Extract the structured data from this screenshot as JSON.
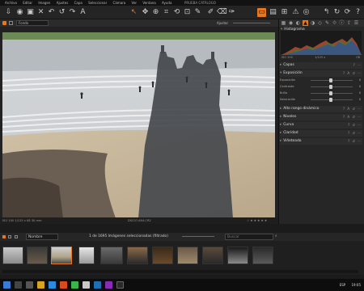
{
  "menu": {
    "items": [
      "Archivo",
      "Editar",
      "Imagen",
      "Ajustes",
      "Capa",
      "Seleccionar",
      "Cámara",
      "Ver",
      "Ventana",
      "Ayuda"
    ],
    "catalog": "PRUEBA CATÁLOGO"
  },
  "viewer": {
    "fondo_label": "Fondo",
    "ajustar_label": "Ajustar",
    "status_left": "ISO 100    1/125 s    f/8    30 mm",
    "status_center": "DSC07-604.CR2",
    "rating": "☆ ★ ★ ★ ★ ★"
  },
  "panel": {
    "histograma": "Histograma",
    "histo_info_left": "ISO 100",
    "histo_info_center": "1/125 s",
    "histo_info_right": "f/8",
    "capas": "Capas",
    "exposicion": "Exposición",
    "sliders": [
      {
        "label": "Exposición",
        "value": "0"
      },
      {
        "label": "Contraste",
        "value": "0"
      },
      {
        "label": "Brillo",
        "value": "0"
      },
      {
        "label": "Saturación",
        "value": "0"
      }
    ],
    "alto_rango": "Alto rango dinámico",
    "niveles": "Niveles",
    "curva": "Curva",
    "claridad": "Claridad",
    "vineteado": "Viñeteado"
  },
  "browser": {
    "sort_label": "Nombre",
    "count_text": "1 de 1695 Imágenes seleccionadas (filtrado)",
    "search_placeholder": "Buscar"
  },
  "taskbar": {
    "lang": "ESP",
    "time": "19:05"
  }
}
